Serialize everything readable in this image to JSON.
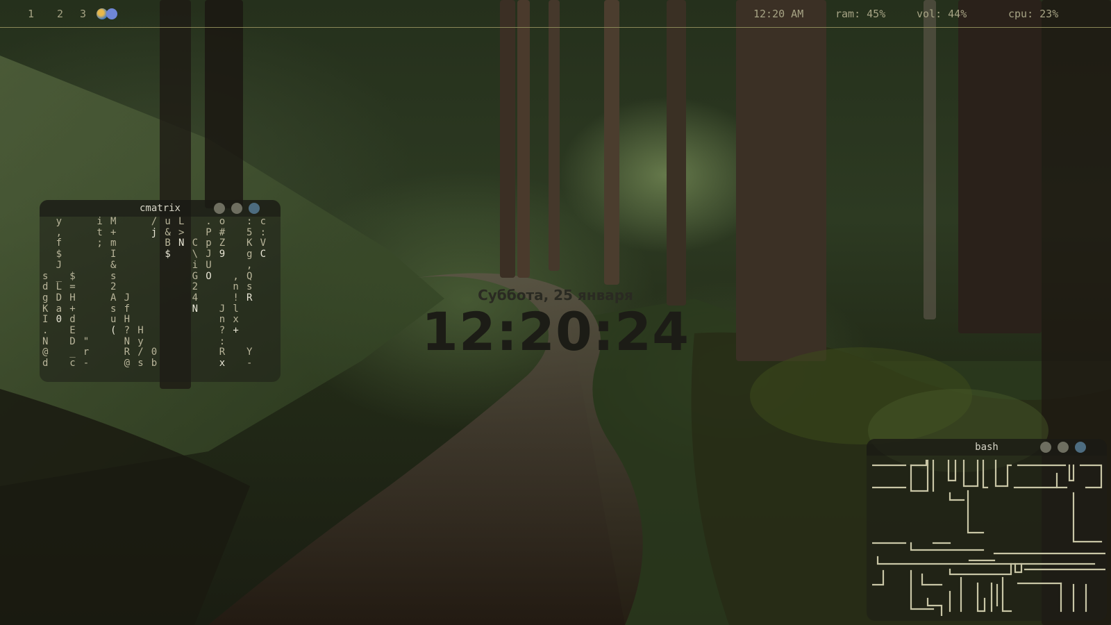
{
  "topbar": {
    "workspaces": [
      "1",
      "2",
      "3"
    ],
    "clock": "12:20 AM",
    "ram": "ram: 45%",
    "vol": "vol: 44%",
    "cpu": "cpu: 23%",
    "tray_icons": [
      "browser-icon",
      "discord-icon"
    ]
  },
  "desktop_clock": {
    "date": "Суббота, 25 января",
    "time": "12:20:24"
  },
  "windows": {
    "cmatrix": {
      "title": "cmatrix"
    },
    "bash": {
      "title": "bash"
    }
  },
  "cmatrix_columns": [
    {
      "dim": "\n\n\n\n\ns\nd\ng\nK\nI\n.\nN\n@\nd",
      "hi": []
    },
    {
      "dim": "y\n,\nf\n$\nJ\n_\nL\nD\na\n0\n\n\n\n",
      "hi": [
        9
      ]
    },
    {
      "dim": "\n\n\n\n\n$\n=\nH\n+\nd\nE\nD\n_\nc",
      "hi": []
    },
    {
      "dim": "\n\n\n\n\n\n\n\n\n\n\n\"\nr\n-",
      "hi": []
    },
    {
      "dim": "i\nt\n;",
      "hi": []
    },
    {
      "dim": "M\n+\nm\nI\n&\ns\n2\nA\ns\nu\n(",
      "hi": [
        10
      ]
    },
    {
      "dim": "\n\n\n\n\n\n\nJ\nf\nH\n?\nN\nR\n@",
      "hi": []
    },
    {
      "dim": "\n\n\n\n\n\n\n\n\n\nH\ny\n/\ns",
      "hi": []
    },
    {
      "dim": "/\nj\n\n\n\n\n\n\n\n\n\n\n0\nb",
      "hi": [
        1
      ]
    },
    {
      "dim": "u\n&\nB\n$",
      "hi": [
        3
      ]
    },
    {
      "dim": "L\n>\nN",
      "hi": [
        2
      ]
    },
    {
      "dim": "\n\nC\n\\\ni\nG\n2\n4\nN",
      "hi": [
        8
      ]
    },
    {
      "dim": ".\nP\np\nJ\nU\nO",
      "hi": [
        5
      ]
    },
    {
      "dim": "o\n#\nZ\n9\n\n\n\n\nJ\nn\n?\n:\nR\nx",
      "hi": [
        3,
        13
      ]
    },
    {
      "dim": "\n\n\n\n\n,\nn\n!\nl\nx\n+",
      "hi": [
        10
      ]
    },
    {
      "dim": ":\n5\nK\ng\n,\nQ\ns\nR\n\n\n\n\nY\n-",
      "hi": [
        7
      ]
    },
    {
      "dim": "c\n:\nV\nC",
      "hi": [
        3
      ]
    }
  ]
}
